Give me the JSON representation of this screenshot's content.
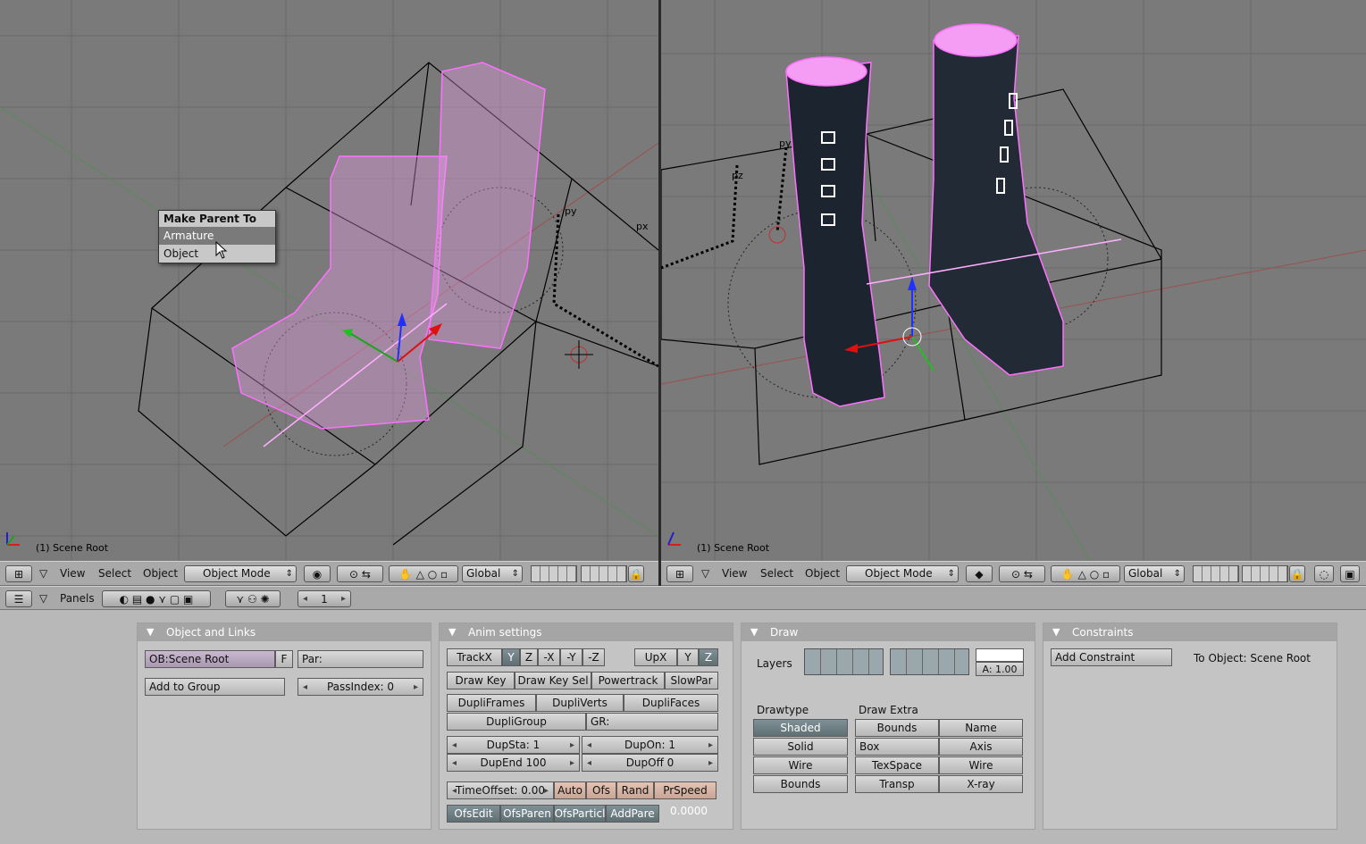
{
  "left_view": {
    "scene_label": "(1) Scene Root",
    "axis_labels": {
      "py": "py",
      "px": "px"
    }
  },
  "right_view": {
    "scene_label": "(1) Scene Root",
    "axis_labels": {
      "py": "py",
      "pz": "pz"
    }
  },
  "popup_menu": {
    "title": "Make Parent To",
    "items": [
      "Armature",
      "Object"
    ],
    "highlighted": "Armature"
  },
  "header_left": {
    "menus": [
      "View",
      "Select",
      "Object"
    ],
    "mode": "Object Mode",
    "orientation": "Global"
  },
  "header_right": {
    "menus": [
      "View",
      "Select",
      "Object"
    ],
    "mode": "Object Mode",
    "orientation": "Global"
  },
  "buttons_window": {
    "panels_label": "Panels",
    "frame_value": "1"
  },
  "object_links": {
    "title": "Object and Links",
    "ob_name": "OB:Scene Root",
    "f_label": "F",
    "parent": "Par:",
    "add_to_group": "Add to Group",
    "pass_index": "PassIndex: 0"
  },
  "anim_settings": {
    "title": "Anim settings",
    "track": [
      "TrackX",
      "Y",
      "Z",
      "-X",
      "-Y",
      "-Z"
    ],
    "up": [
      "UpX",
      "Y",
      "Z"
    ],
    "row2": [
      "Draw Key",
      "Draw Key Sel",
      "Powertrack",
      "SlowPar"
    ],
    "dupli": [
      "DupliFrames",
      "DupliVerts",
      "DupliFaces"
    ],
    "dupligroup": "DupliGroup",
    "gr": "GR:",
    "dupsta": "DupSta: 1",
    "dupon": "DupOn: 1",
    "dupend": "DupEnd 100",
    "dupoff": "DupOff 0",
    "timeoffset": "TimeOffset: 0.00",
    "time_btns": [
      "Auto",
      "Ofs",
      "Rand",
      "PrSpeed"
    ],
    "ofs_btns": [
      "OfsEdit",
      "OfsParen",
      "OfsParticl",
      "AddPare"
    ],
    "value": "0.0000"
  },
  "draw_panel": {
    "title": "Draw",
    "layers_label": "Layers",
    "alpha": "A: 1.00",
    "drawtype_label": "Drawtype",
    "drawtypes": [
      "Shaded",
      "Solid",
      "Wire",
      "Bounds"
    ],
    "drawextra_label": "Draw Extra",
    "bounds": "Bounds",
    "name": "Name",
    "box": "Box",
    "axis": "Axis",
    "texspace": "TexSpace",
    "wire": "Wire",
    "transp": "Transp",
    "xray": "X-ray"
  },
  "constraints": {
    "title": "Constraints",
    "add_constraint": "Add Constraint",
    "to_object": "To Object: Scene Root"
  },
  "colors": {
    "viewport_bg": "#7a7a7a",
    "wire_pink": "#ff80ff",
    "active_btn": "#6a7b80",
    "panel_bg": "#c4c4c4"
  }
}
